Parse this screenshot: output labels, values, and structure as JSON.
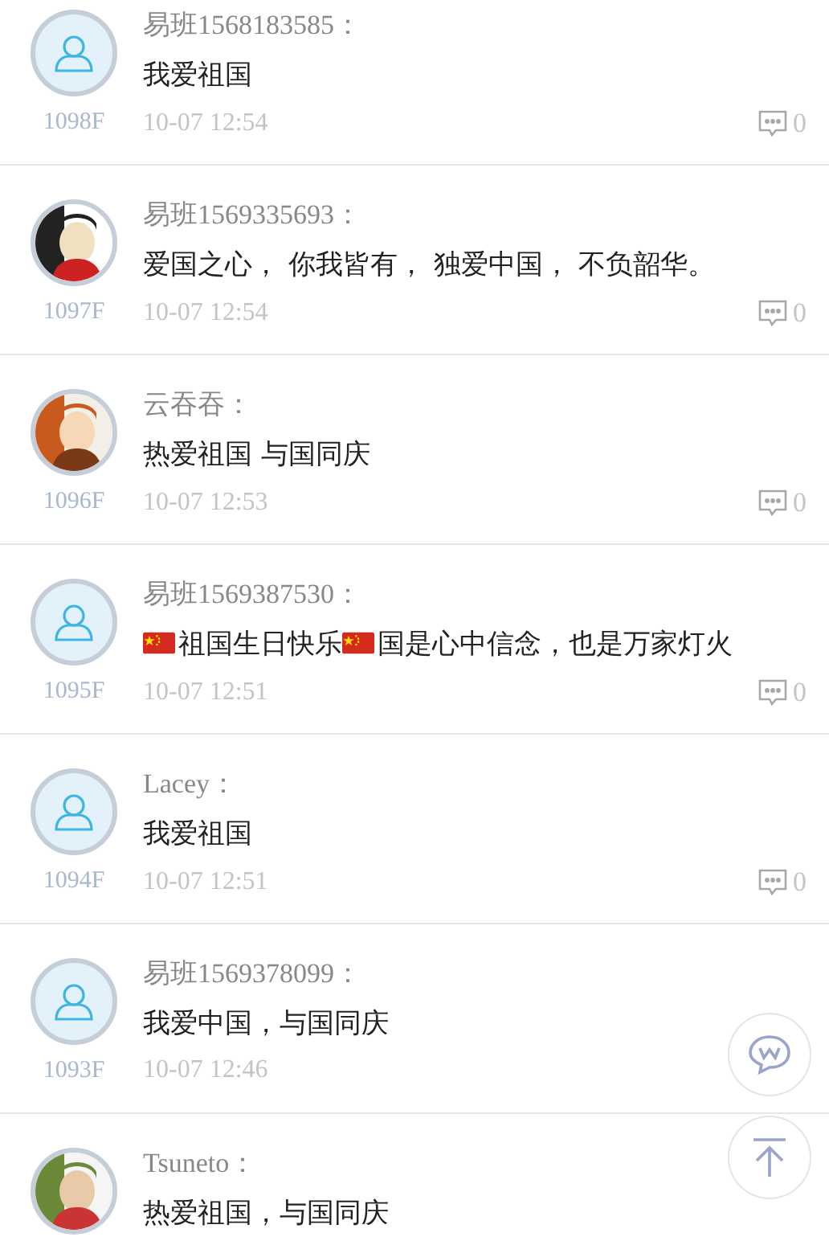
{
  "comments": [
    {
      "avatar": {
        "kind": "default"
      },
      "name": "易班1568183585：",
      "message": [
        {
          "kind": "text",
          "text": "我爱祖国"
        }
      ],
      "floor": "1098F",
      "time": "10-07 12:54",
      "replies": "0"
    },
    {
      "name": "易班1569335693：",
      "message": [
        {
          "kind": "text",
          "text": "爱国之心， 你我皆有， 独爱中国， 不负韶华。"
        }
      ],
      "floor": "1097F",
      "time": "10-07 12:54",
      "replies": "0"
    },
    {
      "name": "云吞吞：",
      "message": [
        {
          "kind": "text",
          "text": "热爱祖国 与国同庆"
        }
      ],
      "floor": "1096F",
      "time": "10-07 12:53",
      "replies": "0"
    },
    {
      "avatar": {
        "kind": "default"
      },
      "name": "易班1569387530：",
      "message": [
        {
          "kind": "flag"
        },
        {
          "kind": "text",
          "text": "祖国生日快乐"
        },
        {
          "kind": "flag"
        },
        {
          "kind": "text",
          "text": "国是心中信念，也是万家灯火"
        }
      ],
      "floor": "1095F",
      "time": "10-07 12:51",
      "replies": "0"
    },
    {
      "avatar": {
        "kind": "default"
      },
      "name": "Lacey：",
      "message": [
        {
          "kind": "text",
          "text": "我爱祖国"
        }
      ],
      "floor": "1094F",
      "time": "10-07 12:51",
      "replies": "0"
    },
    {
      "avatar": {
        "kind": "default"
      },
      "name": "易班1569378099：",
      "message": [
        {
          "kind": "text",
          "text": "我爱中国，与国同庆"
        }
      ],
      "floor": "1093F",
      "time": "10-07 12:46"
    },
    {
      "name": "Tsuneto：",
      "message": [
        {
          "kind": "text",
          "text": "热爱祖国，与国同庆"
        }
      ]
    }
  ]
}
